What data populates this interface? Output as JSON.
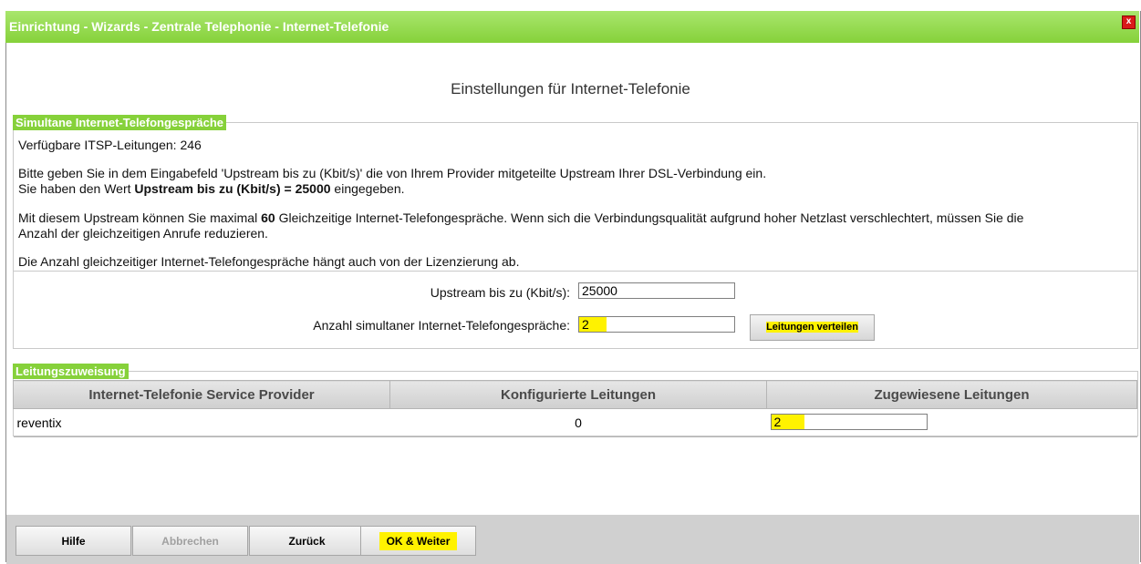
{
  "window": {
    "title": "Einrichtung - Wizards - Zentrale Telephonie - Internet-Telefonie",
    "close_symbol": "x"
  },
  "page_heading": "Einstellungen für Internet-Telefonie",
  "section_calls": {
    "legend": "Simultane Internet-Telefongespräche",
    "available_lines": "Verfügbare ITSP-Leitungen: 246",
    "p1_line1": "Bitte geben Sie in dem Eingabefeld 'Upstream bis zu (Kbit/s)' die von Ihrem Provider mitgeteilte Upstream Ihrer DSL-Verbindung ein.",
    "p1_line2_a": "Sie haben den Wert ",
    "p1_line2_bold": "Upstream bis zu (Kbit/s) = 25000",
    "p1_line2_b": " eingegeben.",
    "p2_a": "Mit diesem Upstream können Sie maximal ",
    "p2_bold": "60",
    "p2_b": " Gleichzeitige Internet-Telefongespräche. Wenn sich die Verbindungsqualität aufgrund hoher Netzlast verschlechtert, müssen Sie die",
    "p2_line2": "Anzahl der gleichzeitigen Anrufe reduzieren.",
    "p3": "Die Anzahl gleichzeitiger Internet-Telefongespräche hängt auch von der Lizenzierung ab."
  },
  "form": {
    "upstream_label": "Upstream bis zu (Kbit/s):",
    "upstream_value": "25000",
    "simultaneous_label": "Anzahl simultaner Internet-Telefongespräche:",
    "simultaneous_value": "2",
    "distribute_button": "Leitungen verteilen"
  },
  "section_assign": {
    "legend": "Leitungszuweisung",
    "columns": [
      "Internet-Telefonie Service Provider",
      "Konfigurierte Leitungen",
      "Zugewiesene Leitungen"
    ],
    "rows": [
      {
        "provider": "reventix",
        "configured": "0",
        "assigned": "2"
      }
    ]
  },
  "footer": {
    "help": "Hilfe",
    "cancel": "Abbrechen",
    "back": "Zurück",
    "ok_next": "OK & Weiter"
  },
  "colors": {
    "accent": "#86d13a",
    "highlight": "#fff200",
    "close": "#d91a1a"
  }
}
